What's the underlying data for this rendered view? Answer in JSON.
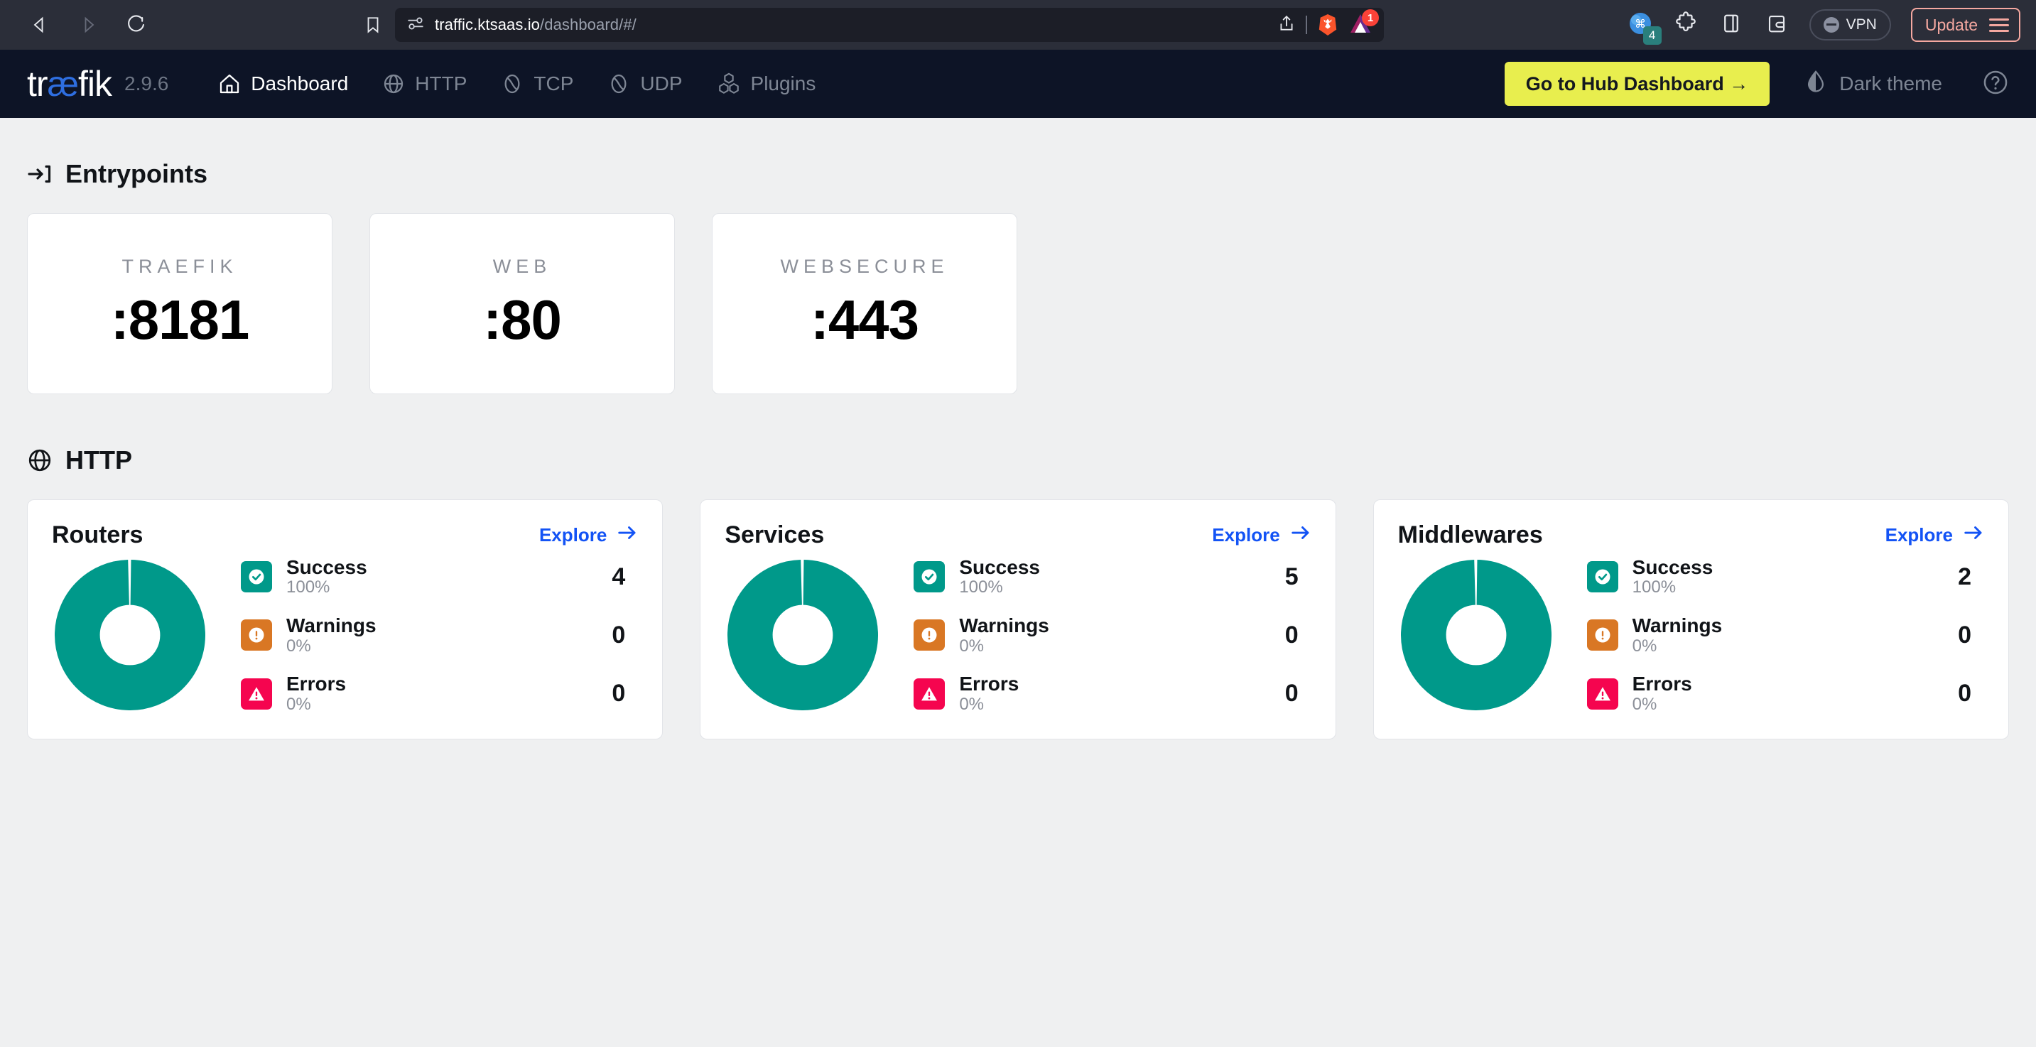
{
  "browser": {
    "back_icon": "back-arrow-icon",
    "forward_icon": "forward-arrow-icon",
    "reload_icon": "reload-icon",
    "bookmark_icon": "bookmark-icon",
    "url_domain": "traffic.ktsaas.io",
    "url_path": "/dashboard/#/",
    "share_icon": "share-icon",
    "brave_shield_icon": "brave-lion-icon",
    "bat_icon": "bat-triangle-icon",
    "bat_badge": "1",
    "ext_command_icon": "command-extension-icon",
    "ext_command_badge": "4",
    "ext_puzzle_icon": "puzzle-extension-icon",
    "sidebar_icon": "sidebar-toggle-icon",
    "wallet_icon": "wallet-icon",
    "vpn_label": "VPN",
    "update_label": "Update",
    "menu_icon": "hamburger-menu-icon",
    "accent_update": "#f5a8a0",
    "chrome_bg": "#2b2e39",
    "urlbar_bg": "#1c1e27"
  },
  "navbar": {
    "logo_pre": "tr",
    "logo_ae": "æ",
    "logo_post": "fik",
    "version": "2.9.6",
    "items": [
      {
        "label": "Dashboard",
        "icon": "home-icon",
        "active": true
      },
      {
        "label": "HTTP",
        "icon": "globe-icon",
        "active": false
      },
      {
        "label": "TCP",
        "icon": "tcp-icon",
        "active": false
      },
      {
        "label": "UDP",
        "icon": "udp-icon",
        "active": false
      },
      {
        "label": "Plugins",
        "icon": "plugins-cubes-icon",
        "active": false
      }
    ],
    "hub_button": "Go to Hub Dashboard →",
    "hub_button_color": "#e8ee4e",
    "theme_label": "Dark theme",
    "theme_icon": "contrast-droplet-icon",
    "help_icon": "help-circle-icon",
    "nav_bg": "#0d1426"
  },
  "entrypoints": {
    "title": "Entrypoints",
    "icon": "entrypoint-arrow-icon",
    "cards": [
      {
        "name": "TRAEFIK",
        "port": ":8181"
      },
      {
        "name": "WEB",
        "port": ":80"
      },
      {
        "name": "WEBSECURE",
        "port": ":443"
      }
    ]
  },
  "http": {
    "title": "HTTP",
    "icon": "globe-icon",
    "explore_label": "Explore",
    "explore_color": "#1353f5",
    "cards": [
      {
        "title": "Routers",
        "stats": [
          {
            "label": "Success",
            "pct": "100%",
            "count": "4",
            "color": "#00998a",
            "icon": "check-circle-icon"
          },
          {
            "label": "Warnings",
            "pct": "0%",
            "count": "0",
            "color": "#d97724",
            "icon": "exclamation-circle-icon"
          },
          {
            "label": "Errors",
            "pct": "0%",
            "count": "0",
            "color": "#f5054f",
            "icon": "warning-triangle-icon"
          }
        ]
      },
      {
        "title": "Services",
        "stats": [
          {
            "label": "Success",
            "pct": "100%",
            "count": "5",
            "color": "#00998a",
            "icon": "check-circle-icon"
          },
          {
            "label": "Warnings",
            "pct": "0%",
            "count": "0",
            "color": "#d97724",
            "icon": "exclamation-circle-icon"
          },
          {
            "label": "Errors",
            "pct": "0%",
            "count": "0",
            "color": "#f5054f",
            "icon": "warning-triangle-icon"
          }
        ]
      },
      {
        "title": "Middlewares",
        "stats": [
          {
            "label": "Success",
            "pct": "100%",
            "count": "2",
            "color": "#00998a",
            "icon": "check-circle-icon"
          },
          {
            "label": "Warnings",
            "pct": "0%",
            "count": "0",
            "color": "#d97724",
            "icon": "exclamation-circle-icon"
          },
          {
            "label": "Errors",
            "pct": "0%",
            "count": "0",
            "color": "#f5054f",
            "icon": "warning-triangle-icon"
          }
        ]
      }
    ]
  },
  "chart_data": [
    {
      "type": "pie",
      "title": "Routers",
      "labels": [
        "Success",
        "Warnings",
        "Errors"
      ],
      "values": [
        4,
        0,
        0
      ],
      "percentages": [
        100,
        0,
        0
      ],
      "colors": [
        "#00998a",
        "#d97724",
        "#f5054f"
      ],
      "donut": true,
      "legend": "right"
    },
    {
      "type": "pie",
      "title": "Services",
      "labels": [
        "Success",
        "Warnings",
        "Errors"
      ],
      "values": [
        5,
        0,
        0
      ],
      "percentages": [
        100,
        0,
        0
      ],
      "colors": [
        "#00998a",
        "#d97724",
        "#f5054f"
      ],
      "donut": true,
      "legend": "right"
    },
    {
      "type": "pie",
      "title": "Middlewares",
      "labels": [
        "Success",
        "Warnings",
        "Errors"
      ],
      "values": [
        2,
        0,
        0
      ],
      "percentages": [
        100,
        0,
        0
      ],
      "colors": [
        "#00998a",
        "#d97724",
        "#f5054f"
      ],
      "donut": true,
      "legend": "right"
    }
  ]
}
